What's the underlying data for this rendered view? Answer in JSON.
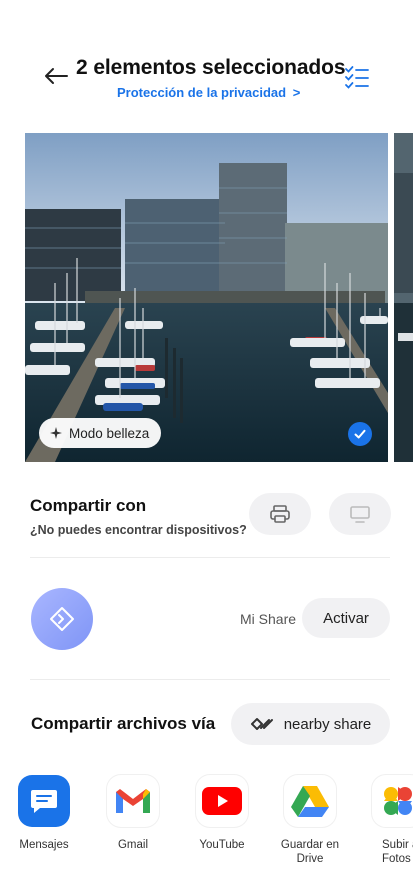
{
  "header": {
    "title": "2 elementos seleccionados",
    "privacy_link": "Protección de la privacidad",
    "privacy_chevron": ">"
  },
  "photo": {
    "beauty_mode": "Modo belleza",
    "selected": true
  },
  "share_with": {
    "title": "Compartir con",
    "subtitle": "¿No puedes encontrar dispositivos?"
  },
  "mi_share": {
    "label": "Mi Share",
    "activate": "Activar"
  },
  "share_via": {
    "title": "Compartir archivos vía",
    "nearby": "nearby share"
  },
  "apps": [
    {
      "label": "Mensajes"
    },
    {
      "label": "Gmail"
    },
    {
      "label": "YouTube"
    },
    {
      "label": "Guardar en Drive"
    },
    {
      "label": "Subir a Fotos"
    }
  ],
  "colors": {
    "accent": "#1a73e8",
    "chip_bg": "#f1f1f3"
  }
}
